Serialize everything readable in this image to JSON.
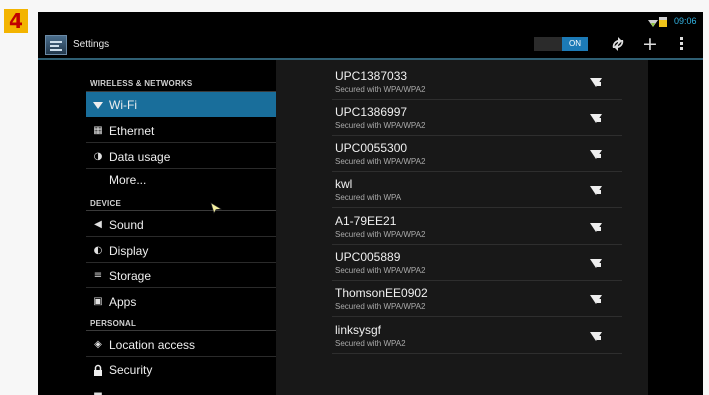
{
  "badge": "4",
  "statusbar": {
    "time": "09:06"
  },
  "actionbar": {
    "title": "Settings",
    "toggle_label": "ON"
  },
  "sidebar": {
    "headers": [
      "WIRELESS & NETWORKS",
      "DEVICE",
      "PERSONAL"
    ],
    "items": [
      {
        "label": "Wi-Fi",
        "icon": "wifi-icon",
        "selected": true
      },
      {
        "label": "Ethernet",
        "icon": "ethernet-icon"
      },
      {
        "label": "Data usage",
        "icon": "data-usage-icon"
      },
      {
        "label": "More...",
        "icon": ""
      },
      {
        "label": "Sound",
        "icon": "speaker-icon"
      },
      {
        "label": "Display",
        "icon": "display-icon"
      },
      {
        "label": "Storage",
        "icon": "storage-icon"
      },
      {
        "label": "Apps",
        "icon": "apps-icon"
      },
      {
        "label": "Location access",
        "icon": "location-icon"
      },
      {
        "label": "Security",
        "icon": "lock-icon"
      }
    ]
  },
  "networks": [
    {
      "ssid": "UPC1387033",
      "security": "Secured with WPA/WPA2"
    },
    {
      "ssid": "UPC1386997",
      "security": "Secured with WPA/WPA2"
    },
    {
      "ssid": "UPC0055300",
      "security": "Secured with WPA/WPA2"
    },
    {
      "ssid": "kwl",
      "security": "Secured with WPA"
    },
    {
      "ssid": "A1-79EE21",
      "security": "Secured with WPA/WPA2"
    },
    {
      "ssid": "UPC005889",
      "security": "Secured with WPA/WPA2"
    },
    {
      "ssid": "ThomsonEE0902",
      "security": "Secured with WPA/WPA2"
    },
    {
      "ssid": "linksysgf",
      "security": "Secured with WPA2"
    }
  ],
  "colors": {
    "accent": "#33b5e5",
    "selected": "#196e9b",
    "badge": "#f3b400"
  }
}
